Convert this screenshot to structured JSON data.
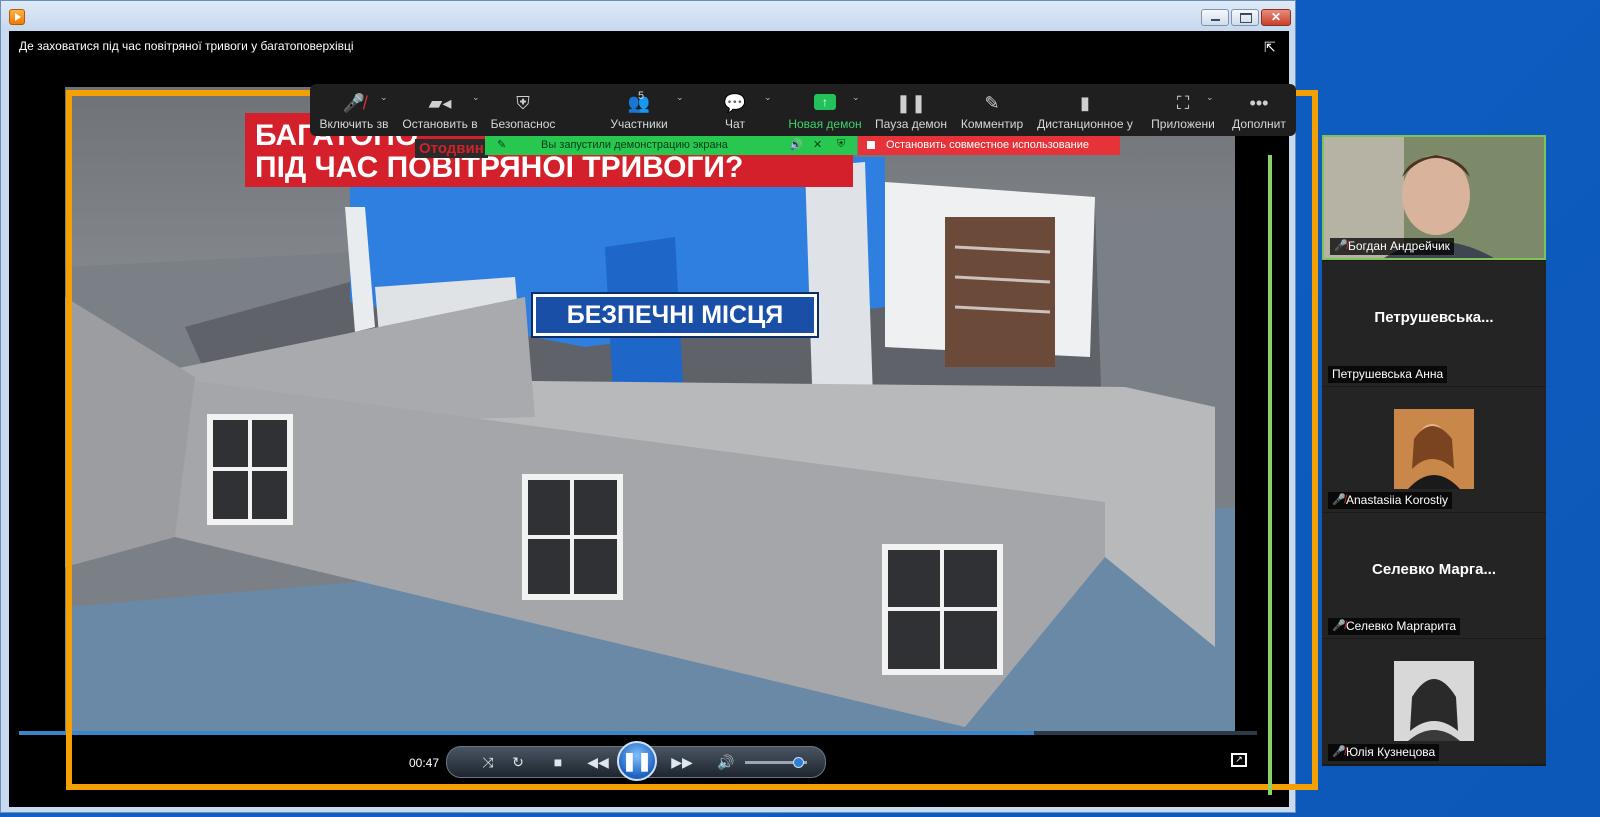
{
  "player": {
    "video_title": "Де заховатися під час повітряної тривоги у багатоповерхівці",
    "elapsed_time": "00:47",
    "progress": 0.82,
    "volume": 0.85
  },
  "video_overlay": {
    "banner_line1": "БАГАТОПО",
    "banner_line2": "ПІД ЧАС ПОВІТРЯНОЇ ТРИВОГИ?",
    "banner_overlay": "Отодвин",
    "safe_places": "БЕЗПЕЧНІ МІСЦЯ"
  },
  "zoom_toolbar": {
    "items": [
      {
        "label": "Включить зв",
        "icon": "mic-muted-icon"
      },
      {
        "label": "Остановить в",
        "icon": "video-camera-icon"
      },
      {
        "label": "Безопаснос",
        "icon": "shield-icon"
      },
      {
        "label": "Участники",
        "icon": "participants-icon",
        "count": "5"
      },
      {
        "label": "Чат",
        "icon": "chat-icon"
      },
      {
        "label": "Новая демон",
        "icon": "share-screen-icon"
      },
      {
        "label": "Пауза демон",
        "icon": "pause-icon"
      },
      {
        "label": "Комментир",
        "icon": "pencil-icon"
      },
      {
        "label": "Дистанционное у",
        "icon": "mouse-icon"
      },
      {
        "label": "Приложени",
        "icon": "apps-icon"
      },
      {
        "label": "Дополнит",
        "icon": "more-icon"
      }
    ],
    "share_status": "Вы запустили демонстрацию экрана",
    "stop_share": "Остановить совместное использование",
    "accent_green": "#28c850",
    "accent_red": "#e8323a"
  },
  "participants": [
    {
      "name": "Богдан Андрейчик",
      "muted": true,
      "video": true
    },
    {
      "name": "Петрушевська Анна",
      "display": "Петрушевська...",
      "muted": false,
      "video": false
    },
    {
      "name": "Anastasiia Korostiy",
      "muted": true,
      "video": false
    },
    {
      "name": "Селевко Маргарита",
      "display": "Селевко Марга...",
      "muted": true,
      "video": false
    },
    {
      "name": "Юлія Кузнецова",
      "muted": true,
      "video": false
    }
  ],
  "colors": {
    "share_border": "#f3a000",
    "active_speaker": "#7ec35a"
  }
}
